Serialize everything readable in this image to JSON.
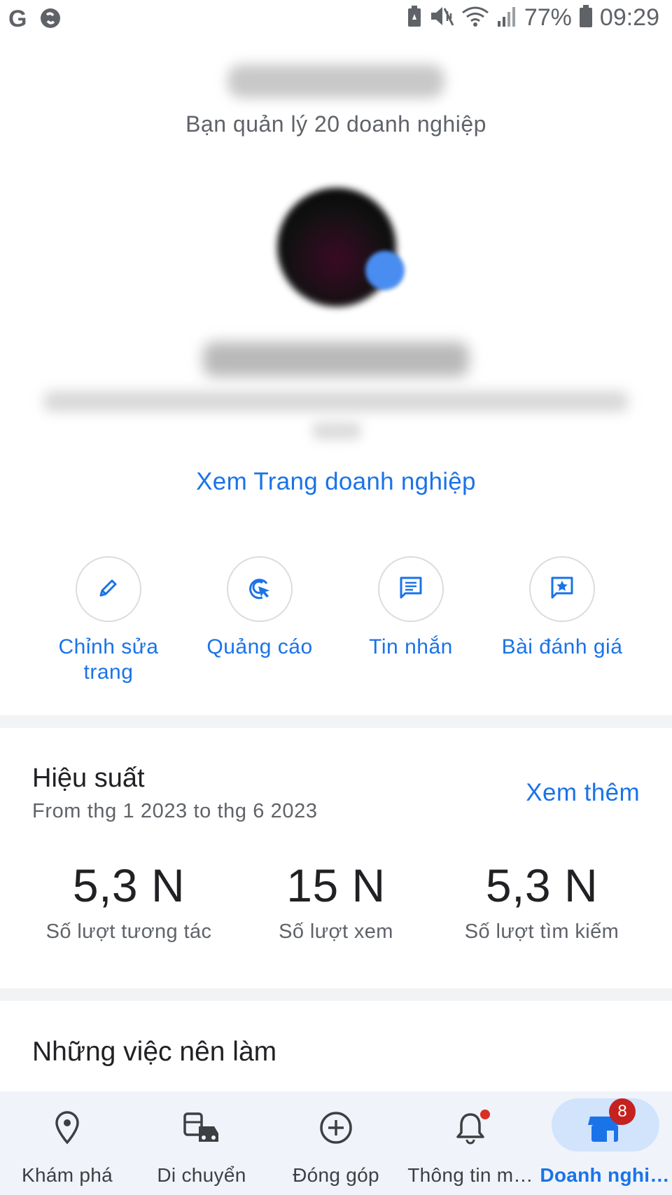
{
  "status_bar": {
    "battery": "77%",
    "time": "09:29",
    "icons": [
      "google-g-icon",
      "shazam-icon",
      "battery-saver-icon",
      "mute-vibrate-icon",
      "wifi-icon",
      "signal-icon",
      "battery-icon"
    ]
  },
  "account": {
    "managed_text": "Bạn quản lý 20 doanh nghiệp"
  },
  "business": {
    "view_page_link": "Xem Trang doanh nghiệp"
  },
  "actions": [
    {
      "label": "Chỉnh sửa trang",
      "icon": "pencil-icon"
    },
    {
      "label": "Quảng cáo",
      "icon": "ads-target-icon"
    },
    {
      "label": "Tin nhắn",
      "icon": "message-icon"
    },
    {
      "label": "Bài đánh giá",
      "icon": "review-star-icon"
    }
  ],
  "performance": {
    "title": "Hiệu suất",
    "range": "From thg 1 2023 to thg 6 2023",
    "see_more": "Xem thêm",
    "stats": [
      {
        "value": "5,3 N",
        "label": "Số lượt tương tác"
      },
      {
        "value": "15 N",
        "label": "Số lượt xem"
      },
      {
        "value": "5,3 N",
        "label": "Số lượt tìm kiếm"
      }
    ]
  },
  "todo": {
    "title": "Những việc nên làm"
  },
  "bottom_nav": {
    "items": [
      {
        "label": "Khám phá",
        "icon": "location-pin-icon"
      },
      {
        "label": "Di chuyển",
        "icon": "commute-icon"
      },
      {
        "label": "Đóng góp",
        "icon": "add-circle-icon"
      },
      {
        "label": "Thông tin m…",
        "icon": "bell-icon"
      },
      {
        "label": "Doanh nghi…",
        "icon": "storefront-icon",
        "badge": "8"
      }
    ],
    "active_color": "#1a73e8"
  },
  "colors": {
    "accent": "#1a73e8",
    "badge": "#c5221f"
  }
}
